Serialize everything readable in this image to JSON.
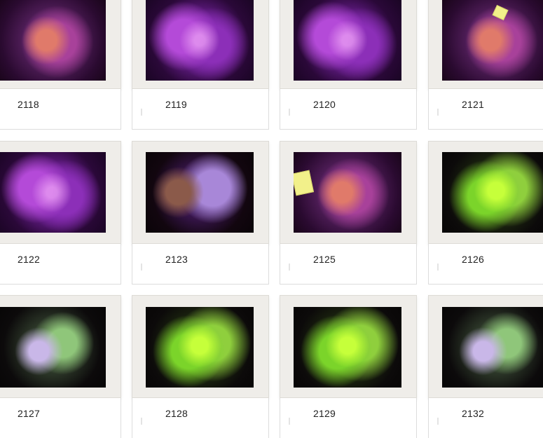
{
  "gallery": {
    "items": [
      {
        "id": "2118",
        "style": "orange"
      },
      {
        "id": "2119",
        "style": "purple"
      },
      {
        "id": "2120",
        "style": "purple"
      },
      {
        "id": "2121",
        "style": "orange"
      },
      {
        "id": "2122",
        "style": "purple"
      },
      {
        "id": "2123",
        "style": "lavender"
      },
      {
        "id": "2125",
        "style": "orange"
      },
      {
        "id": "2126",
        "style": "green"
      },
      {
        "id": "2127",
        "style": "pale"
      },
      {
        "id": "2128",
        "style": "green"
      },
      {
        "id": "2129",
        "style": "green"
      },
      {
        "id": "2132",
        "style": "pale"
      }
    ]
  }
}
